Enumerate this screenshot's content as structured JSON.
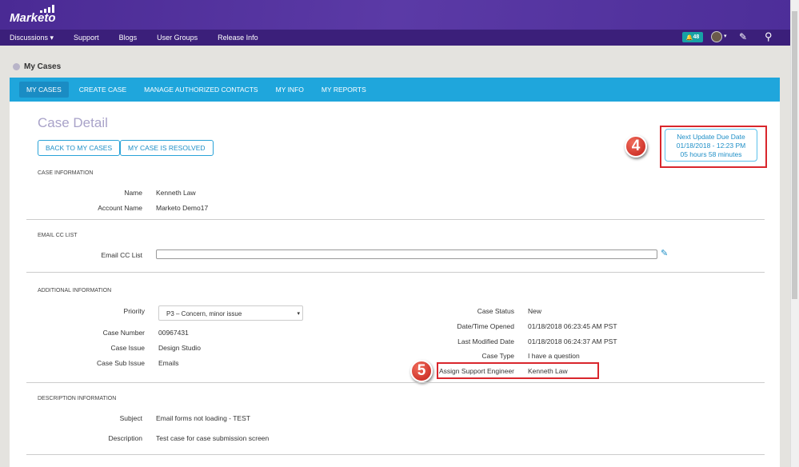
{
  "header": {
    "logo": "Marketo",
    "nav": [
      "Discussions ▾",
      "Support",
      "Blogs",
      "User Groups",
      "Release Info"
    ],
    "notifications": "48"
  },
  "page_heading": "My Cases",
  "tabs": [
    {
      "label": "MY CASES",
      "active": true
    },
    {
      "label": "CREATE CASE"
    },
    {
      "label": "MANAGE AUTHORIZED CONTACTS"
    },
    {
      "label": "MY INFO"
    },
    {
      "label": "MY REPORTS"
    }
  ],
  "case": {
    "title": "Case Detail",
    "back_button": "BACK TO MY CASES",
    "resolved_button": "MY CASE IS RESOLVED",
    "due": {
      "line1": "Next Update Due Date",
      "line2": "01/18/2018 - 12:23 PM",
      "line3": "05 hours 58 minutes"
    },
    "annotations": {
      "a4": "4",
      "a5": "5"
    },
    "case_info": {
      "heading": "CASE INFORMATION",
      "name_label": "Name",
      "name": "Kenneth Law",
      "account_label": "Account Name",
      "account": "Marketo Demo17"
    },
    "email_cc": {
      "heading": "EMAIL CC LIST",
      "label": "Email CC List",
      "value": ""
    },
    "additional": {
      "heading": "ADDITIONAL INFORMATION",
      "priority_label": "Priority",
      "priority": "P3 – Concern, minor issue",
      "case_number_label": "Case Number",
      "case_number": "00967431",
      "case_issue_label": "Case Issue",
      "case_issue": "Design Studio",
      "sub_issue_label": "Case Sub Issue",
      "sub_issue": "Emails",
      "status_label": "Case Status",
      "status": "New",
      "opened_label": "Date/Time Opened",
      "opened": "01/18/2018 06:23:45 AM PST",
      "modified_label": "Last Modified Date",
      "modified": "01/18/2018 06:24:37 AM PST",
      "type_label": "Case Type",
      "type": "I have a question",
      "engineer_label": "Assign Support Engineer",
      "engineer": "Kenneth Law"
    },
    "description": {
      "heading": "DESCRIPTION INFORMATION",
      "subject_label": "Subject",
      "subject": "Email forms not loading - TEST",
      "desc_label": "Description",
      "desc": "Test case for case submission screen"
    }
  },
  "colors": {
    "tab_bar": "#1fa6dc",
    "header": "#4a2a94",
    "annotation_red": "#d9262c"
  }
}
